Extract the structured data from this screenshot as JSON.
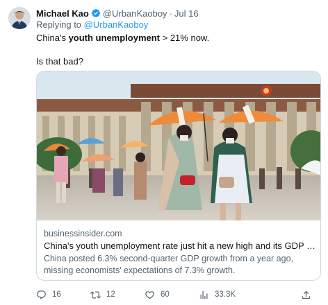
{
  "author": {
    "name": "Michael Kao",
    "handle": "@UrbanKaoboy",
    "separator": "·",
    "time": "Jul 16",
    "verified_icon": "verified-badge-icon"
  },
  "reply": {
    "prefix": "Replying to",
    "mention": "@UrbanKaoboy"
  },
  "tweet": {
    "line1_pre": "China's ",
    "line1_bold": "youth unemployment",
    "line1_post": " > 21% now.",
    "line2": "Is that bad?"
  },
  "card": {
    "domain": "businessinsider.com",
    "title": "China's youth unemployment rate just hit a new high and its GDP gro...",
    "description": "China posted 6.3% second-quarter GDP growth from a year ago, missing economists' expectations of 7.3% growth."
  },
  "actions": {
    "replies": "16",
    "retweets": "12",
    "likes": "60",
    "views": "33.3K",
    "icons": [
      "reply-icon",
      "retweet-icon",
      "like-icon",
      "views-icon",
      "share-icon"
    ]
  },
  "colors": {
    "accent": "#1d9bf0",
    "muted": "#536471",
    "text": "#0f1419",
    "border": "#cfd9de"
  }
}
